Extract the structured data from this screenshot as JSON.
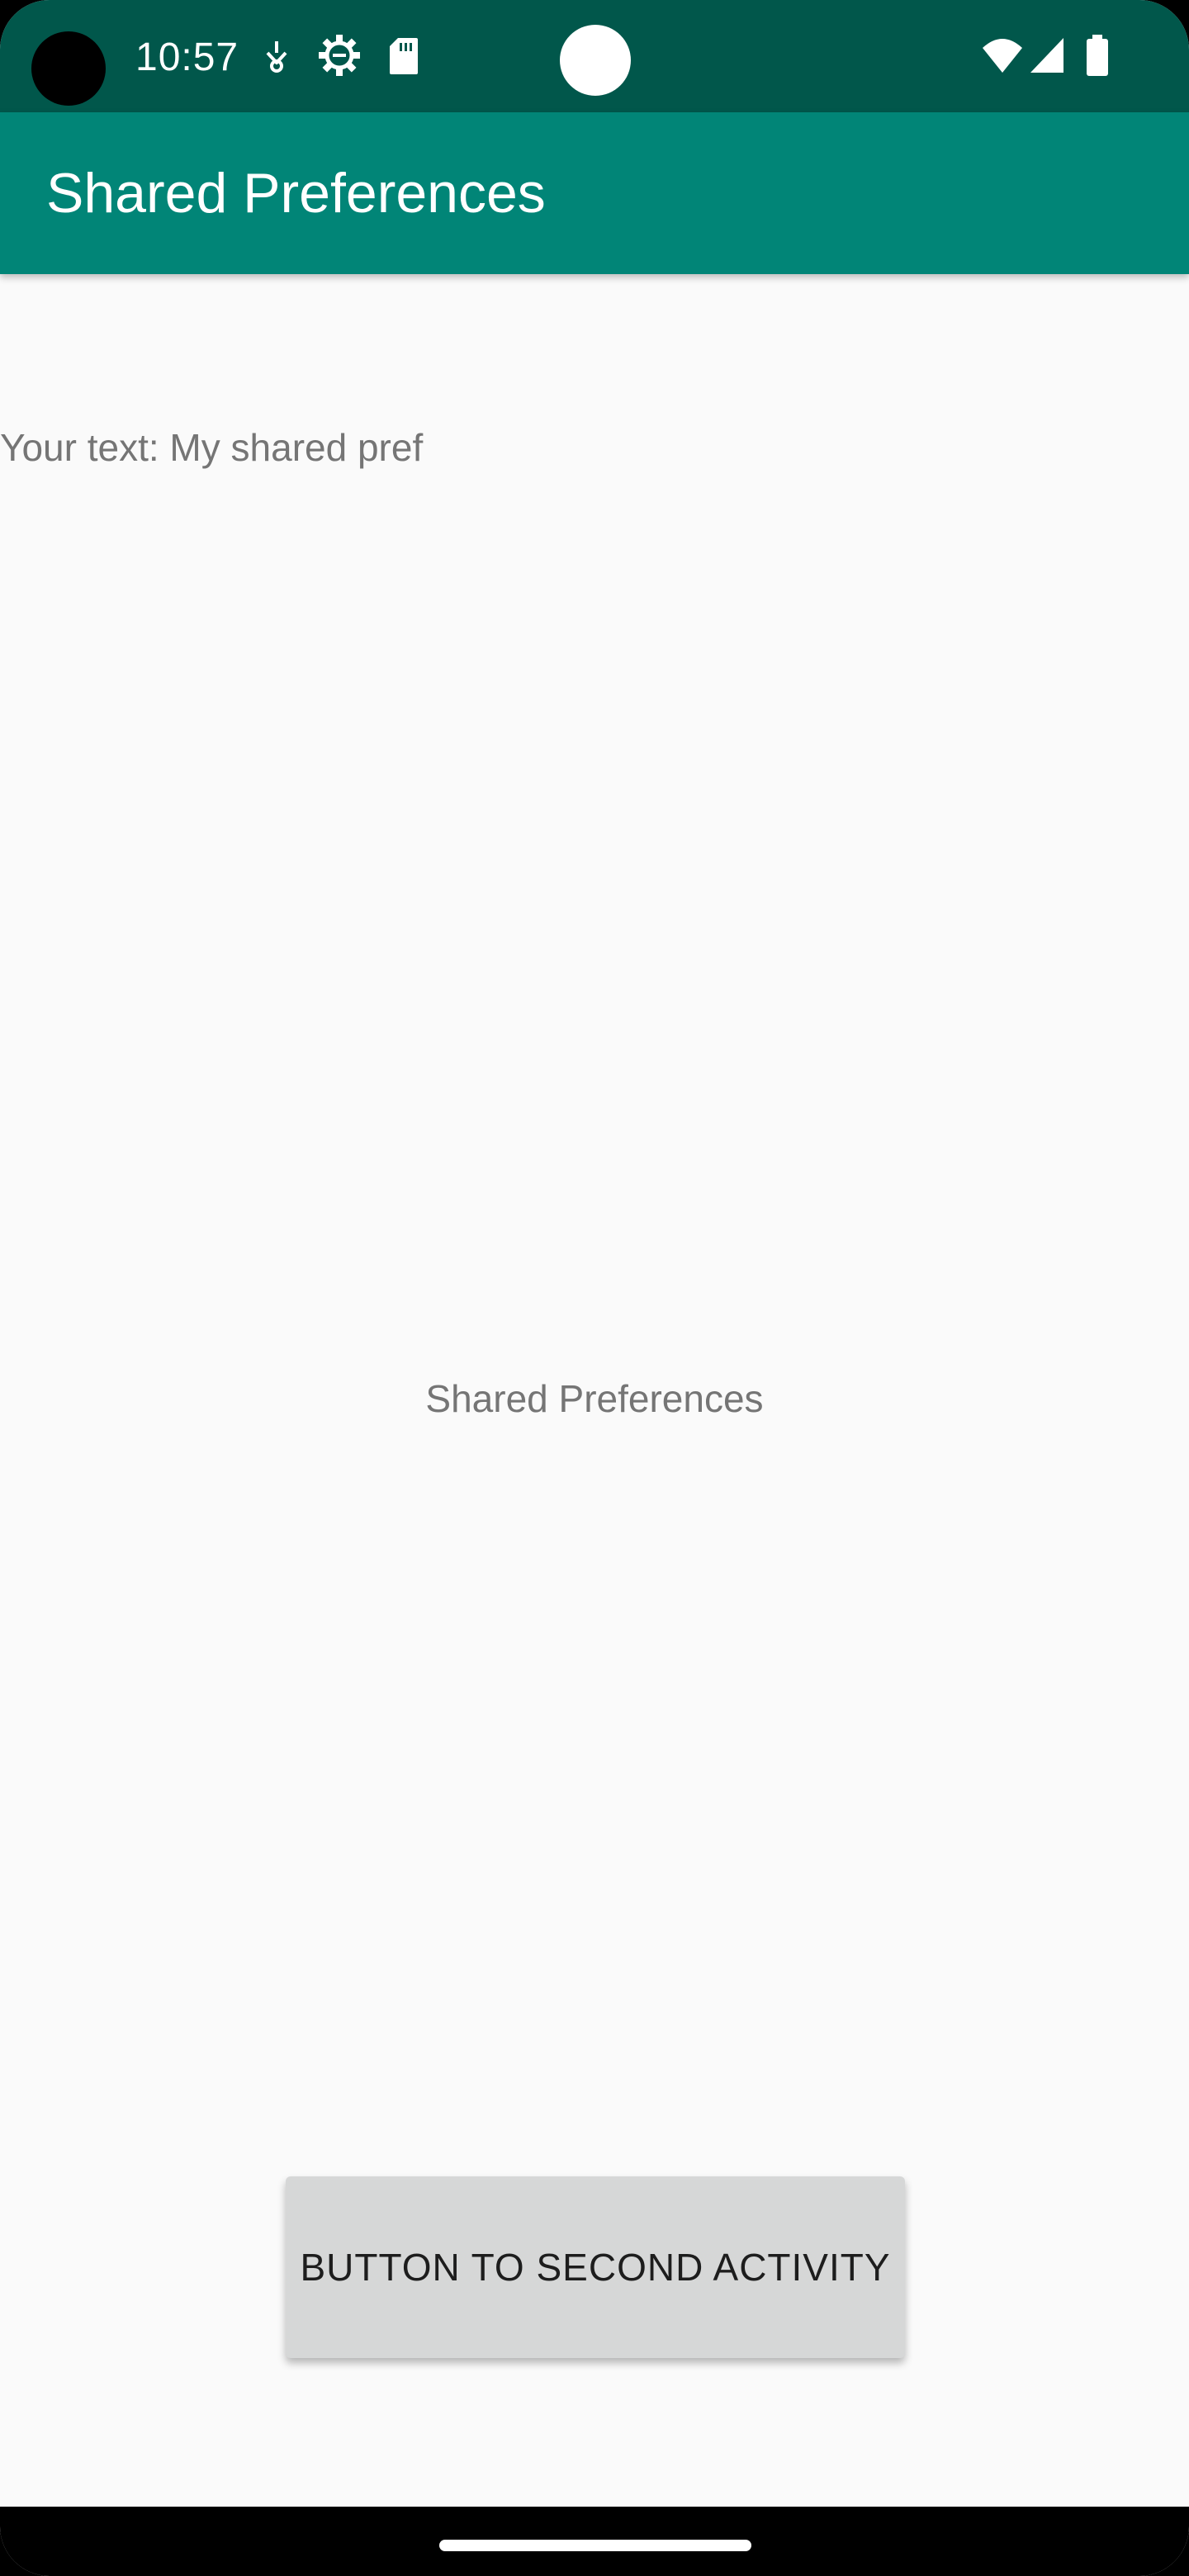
{
  "status_bar": {
    "time": "10:57",
    "left_icons": [
      "pin-icon",
      "settings-gear-icon",
      "sd-card-icon"
    ],
    "right_icons": [
      "wifi-icon",
      "signal-icon",
      "battery-icon"
    ],
    "background_color": "#01574b"
  },
  "app_bar": {
    "title": "Shared Preferences",
    "background_color": "#018577"
  },
  "content": {
    "your_text": "Your text: My shared pref",
    "center_label": "Shared Preferences",
    "button_label": "BUTTON TO SECOND ACTIVITY"
  },
  "nav_bar": {
    "home_indicator": "home-pill"
  }
}
